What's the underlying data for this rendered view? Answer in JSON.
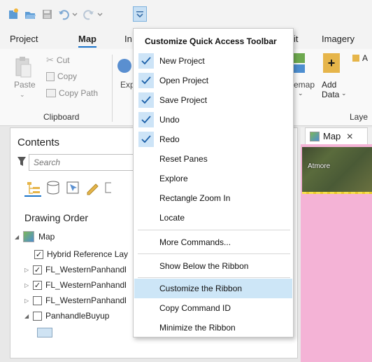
{
  "qat": {
    "icons": [
      "new-project-icon",
      "open-project-icon",
      "save-project-icon",
      "undo-icon",
      "redo-icon",
      "customize-qat-icon"
    ]
  },
  "ribbon": {
    "tabs": [
      "Project",
      "Map",
      "In",
      "it",
      "Imagery"
    ],
    "clipboard": {
      "paste": "Paste",
      "cut": "Cut",
      "copy": "Copy",
      "copy_path": "Copy Path",
      "group_label": "Clipboard"
    },
    "explore_partial": "Exp",
    "basemap_partial": "emap",
    "add_data": "Add",
    "add_data2": "Data",
    "layer_group_partial": "Laye",
    "partial_a": "A"
  },
  "contents": {
    "title": "Contents",
    "search_placeholder": "Search",
    "drawing_order": "Drawing Order",
    "map_name": "Map",
    "layers": [
      {
        "name": "Hybrid Reference Lay",
        "checked": true
      },
      {
        "name": "FL_WesternPanhandl",
        "checked": true
      },
      {
        "name": "FL_WesternPanhandl",
        "checked": true
      },
      {
        "name": "FL_WesternPanhandl",
        "checked": false
      },
      {
        "name": "PanhandleBuyup",
        "checked": false
      }
    ]
  },
  "map_pane": {
    "tab": "Map",
    "close": "✕",
    "place_label": "Atmore"
  },
  "menu": {
    "header": "Customize Quick Access Toolbar",
    "items": [
      {
        "label": "New Project",
        "checked": true
      },
      {
        "label": "Open Project",
        "checked": true
      },
      {
        "label": "Save Project",
        "checked": true
      },
      {
        "label": "Undo",
        "checked": true
      },
      {
        "label": "Redo",
        "checked": true
      },
      {
        "label": "Reset Panes",
        "checked": false
      },
      {
        "label": "Explore",
        "checked": false
      },
      {
        "label": "Rectangle Zoom In",
        "checked": false
      },
      {
        "label": "Locate",
        "checked": false
      },
      {
        "label": "More Commands...",
        "checked": false
      },
      {
        "label": "Show Below the Ribbon",
        "checked": false
      },
      {
        "label": "Customize the Ribbon",
        "checked": false,
        "highlighted": true
      },
      {
        "label": "Copy Command ID",
        "checked": false
      },
      {
        "label": "Minimize the Ribbon",
        "checked": false
      }
    ]
  },
  "colors": {
    "accent": "#1a73c9",
    "menu_highlight": "#cde6f7",
    "map_fill": "#f4b3d6"
  }
}
